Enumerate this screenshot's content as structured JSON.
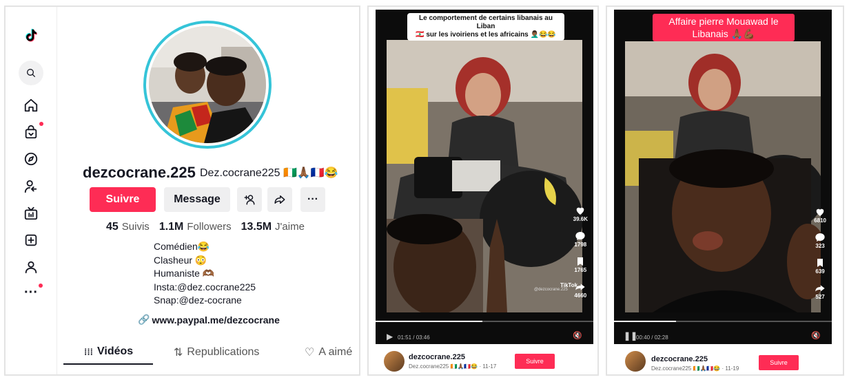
{
  "profile": {
    "username": "dezcocrane.225",
    "nickname": "Dez.cocrane225 🇨🇮🙏🏾🇫🇷😂",
    "follow_label": "Suivre",
    "message_label": "Message",
    "stats": [
      {
        "value": "45",
        "label": "Suivis"
      },
      {
        "value": "1.1M",
        "label": "Followers"
      },
      {
        "value": "13.5M",
        "label": "J'aime"
      }
    ],
    "bio": [
      "Comédien😂",
      "Clasheur 😳",
      "Humaniste 🫶🏾",
      "Insta:@dez.cocrane225",
      "Snap:@dez-cocrane"
    ],
    "link": "www.paypal.me/dezcocrane",
    "tabs": [
      "Vidéos",
      "Republications",
      "A aimé"
    ]
  },
  "video1": {
    "caption_line1": "Le comportement de certains libanais au Liban",
    "caption_line2": "🇱🇧 sur les ivoiriens et les africains 🤦🏾‍♂️😂😂",
    "likes": "39.6K",
    "comments": "1798",
    "saves": "1765",
    "shares": "4660",
    "watermark": "TikTok",
    "watermark_user": "@dezcocrane.225",
    "time": "01:51 / 03:46",
    "author": "dezcocrane.225",
    "author_sub": "Dez.cocrane225 🇨🇮🙏🏾🇫🇷😂 · 11-17",
    "follow_label": "Suivre"
  },
  "video2": {
    "caption_line1": "Affaire pierre Mouawad le",
    "caption_line2": "Libanais 🙏🏾💪🏾",
    "likes": "6810",
    "comments": "323",
    "saves": "639",
    "shares": "527",
    "time": "00:40 / 02:28",
    "author": "dezcocrane.225",
    "author_sub": "Dez.cocrane225 🇨🇮🙏🏾🇫🇷😂 · 11-19",
    "follow_label": "Suivre"
  },
  "colors": {
    "accent": "#fe2c55",
    "ring": "#35c4d8"
  },
  "icons": [
    "tiktok-logo",
    "search-icon",
    "home-icon",
    "shop-icon",
    "explore-icon",
    "following-icon",
    "live-icon",
    "upload-icon",
    "profile-icon",
    "more-icon"
  ]
}
